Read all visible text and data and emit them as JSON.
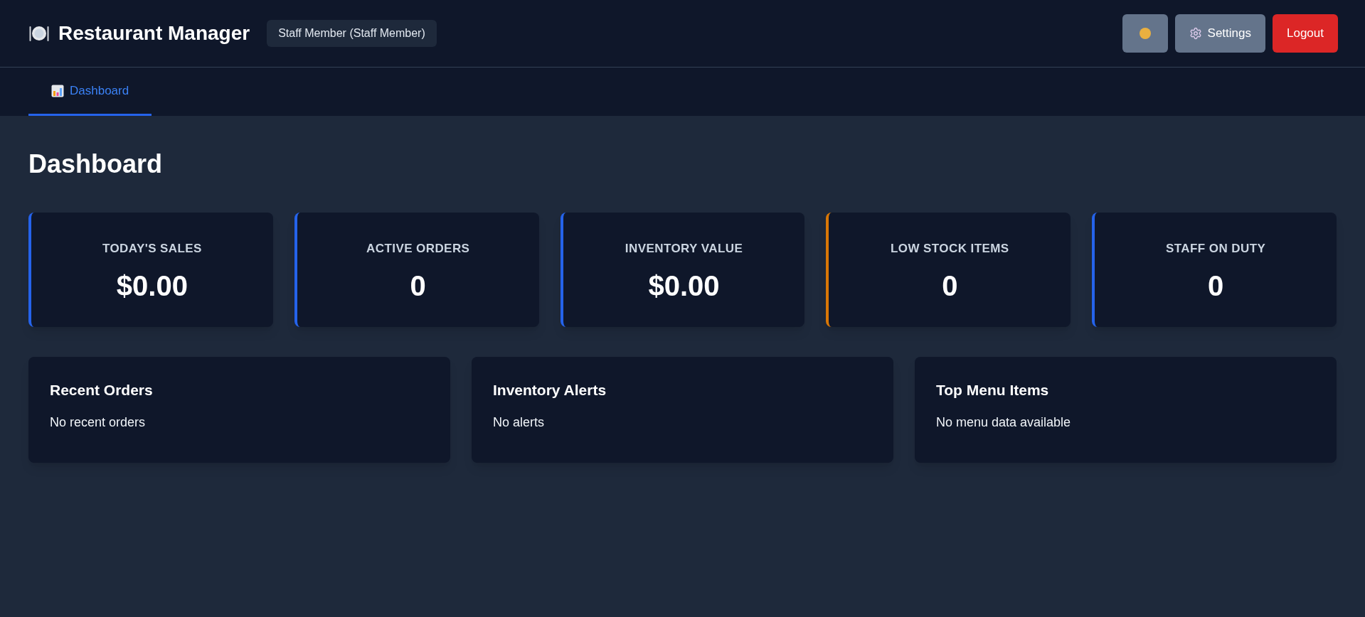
{
  "header": {
    "title": "Restaurant Manager",
    "user_badge": "Staff Member (Staff Member)",
    "buttons": [
      {
        "kind": "theme"
      },
      {
        "kind": "settings",
        "label": "Settings"
      },
      {
        "kind": "logout",
        "label": "Logout"
      }
    ]
  },
  "tabs": [
    {
      "label": "Dashboard",
      "selected": true
    }
  ],
  "page_title": "Dashboard",
  "stats": [
    {
      "label": "TODAY'S SALES",
      "value": "$0.00",
      "color": "#2563eb"
    },
    {
      "label": "ACTIVE ORDERS",
      "value": "0",
      "color": "#2563eb"
    },
    {
      "label": "INVENTORY VALUE",
      "value": "$0.00",
      "color": "#2563eb"
    },
    {
      "label": "LOW STOCK ITEMS",
      "value": "0",
      "color": "#d97706"
    },
    {
      "label": "STAFF ON DUTY",
      "value": "0",
      "color": "#2563eb"
    }
  ],
  "panels": [
    {
      "title": "Recent Orders",
      "message": "No recent orders"
    },
    {
      "title": "Inventory Alerts",
      "message": "No alerts"
    },
    {
      "title": "Top Menu Items",
      "message": "No menu data available"
    }
  ]
}
